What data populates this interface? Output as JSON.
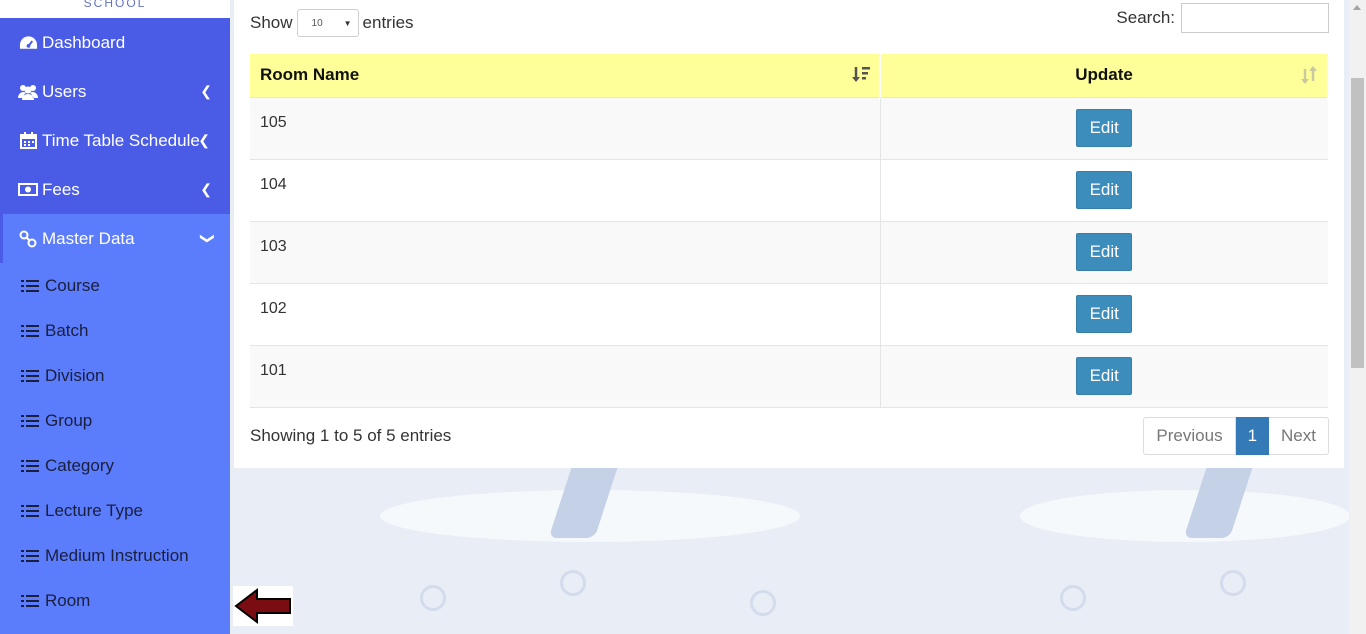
{
  "sidebar": {
    "logo_text": "SCHOOL",
    "items": [
      {
        "label": "Dashboard",
        "icon": "dashboard-icon",
        "has_chevron": false
      },
      {
        "label": "Users",
        "icon": "users-icon",
        "has_chevron": true
      },
      {
        "label": "Time Table Schedule",
        "icon": "calendar-icon",
        "has_chevron": true
      },
      {
        "label": "Fees",
        "icon": "money-icon",
        "has_chevron": true
      },
      {
        "label": "Master Data",
        "icon": "link-icon",
        "has_chevron": true,
        "expanded": true
      }
    ],
    "submenu": [
      "Course",
      "Batch",
      "Division",
      "Group",
      "Category",
      "Lecture Type",
      "Medium Instruction",
      "Room"
    ]
  },
  "controls": {
    "show_label": "Show",
    "entries_label": "entries",
    "page_size": "10",
    "search_label": "Search:"
  },
  "table": {
    "headers": [
      "Room Name",
      "Update"
    ],
    "rows": [
      {
        "room": "105",
        "action": "Edit"
      },
      {
        "room": "104",
        "action": "Edit"
      },
      {
        "room": "103",
        "action": "Edit"
      },
      {
        "room": "102",
        "action": "Edit"
      },
      {
        "room": "101",
        "action": "Edit"
      }
    ]
  },
  "footer": {
    "info": "Showing 1 to 5 of 5 entries",
    "previous": "Previous",
    "current_page": "1",
    "next": "Next"
  },
  "colors": {
    "sidebar_top": "#4a5ce6",
    "sidebar_sub": "#5b7cfb",
    "header_bg": "#ffff99",
    "edit_button": "#3c8dbc",
    "pointer_arrow": "#7b0d12"
  }
}
